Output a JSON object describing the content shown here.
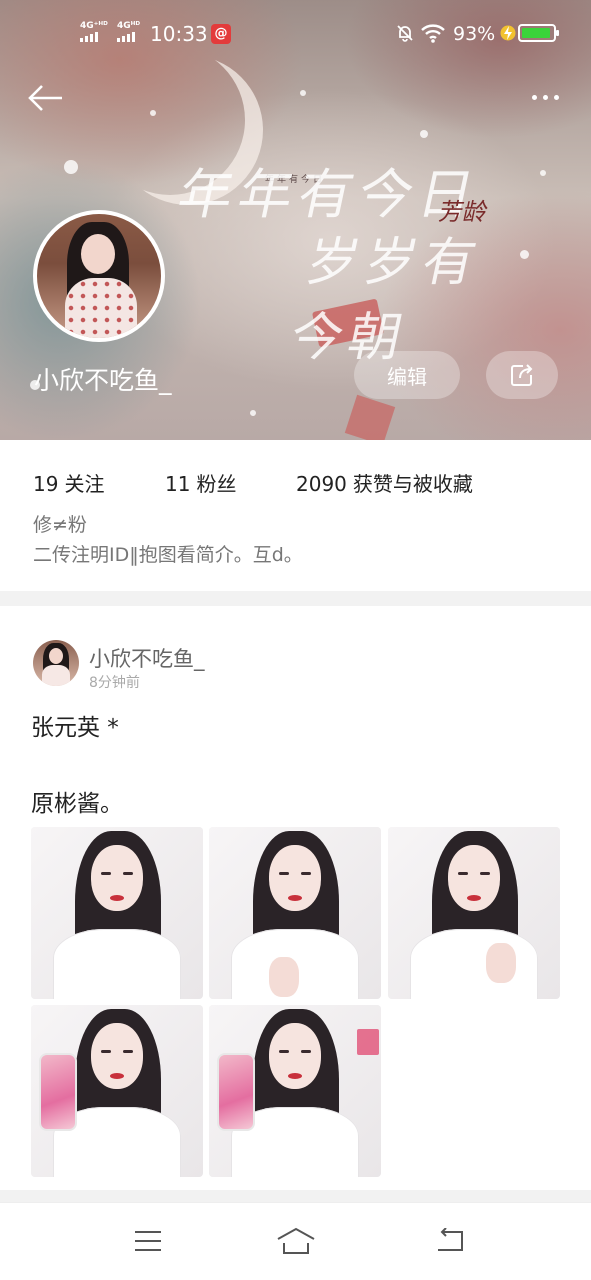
{
  "status_bar": {
    "network_1": "4G⁺ᴴᴰ",
    "network_2": "4Gᴴᴰ",
    "time": "10:33",
    "app_badge": "@",
    "battery_percent": "93%",
    "battery_level": 0.93,
    "battery_color": "#3ad33a"
  },
  "header": {
    "back_icon": "arrow-left-icon",
    "more_icon": "more-dots-icon",
    "cover_text_small": "年年有今日",
    "cover_text_line1": "年年有今日",
    "cover_text_line2": "岁岁有今朝",
    "cover_text_accent": "芳龄",
    "profile_name": "小欣不吃鱼_",
    "edit_label": "编辑",
    "share_icon": "share-icon"
  },
  "stats": [
    {
      "count": "19",
      "label": "关注"
    },
    {
      "count": "11",
      "label": "粉丝"
    },
    {
      "count": "2090",
      "label": "获赞与被收藏"
    }
  ],
  "bio": {
    "line1": "修≠粉",
    "line2": "二传注明ID‖抱图看简介。互d。"
  },
  "post": {
    "author": "小欣不吃鱼_",
    "time": "8分钟前",
    "text_line1": "张元英 *",
    "text_line2": "原彬酱。",
    "photo_count": 5
  },
  "bottom_nav": {
    "menu_icon": "menu-icon",
    "home_icon": "home-icon",
    "back_icon": "back-return-icon"
  },
  "colors": {
    "accent_red": "#e33b3b",
    "cover_red": "#c96461",
    "text_main": "#222222",
    "text_muted": "#777777"
  }
}
